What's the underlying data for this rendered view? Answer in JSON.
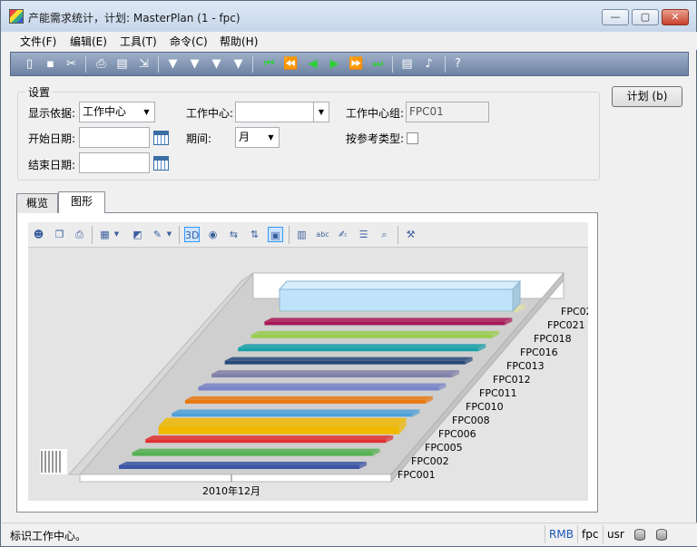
{
  "window": {
    "title": "产能需求统计，计划: MasterPlan (1 - fpc)",
    "controls": {
      "minimize": "—",
      "maximize": "▢",
      "close": "✕"
    }
  },
  "menu": {
    "items": [
      {
        "label": "文件(F)"
      },
      {
        "label": "编辑(E)"
      },
      {
        "label": "工具(T)"
      },
      {
        "label": "命令(C)"
      },
      {
        "label": "帮助(H)"
      }
    ]
  },
  "toolbar": {
    "icons": [
      "new-icon",
      "save-icon",
      "cut-icon",
      "print-icon",
      "print-preview-icon",
      "export-icon",
      "filter-icon",
      "filter-add-icon",
      "filter-edit-icon",
      "filter-clear-icon",
      "first-record-icon",
      "previous-page-icon",
      "previous-record-icon",
      "next-record-icon",
      "next-page-icon",
      "last-record-icon",
      "notes-icon",
      "alert-bell-icon",
      "help-icon"
    ]
  },
  "settings": {
    "group_label": "设置",
    "display_by_label": "显示依据:",
    "display_by_value": "工作中心",
    "work_center_label": "工作中心:",
    "work_center_value": "",
    "work_center_group_label": "工作中心组:",
    "work_center_group_value": "FPC01",
    "start_date_label": "开始日期:",
    "start_date_value": "",
    "period_label": "期间:",
    "period_value": "月",
    "by_ref_type_label": "按参考类型:",
    "by_ref_type_checked": false,
    "end_date_label": "结束日期:",
    "end_date_value": "",
    "plan_button": "计划 (b)"
  },
  "tabs": [
    {
      "label": "概览",
      "active": false
    },
    {
      "label": "图形",
      "active": true
    }
  ],
  "chart_toolbar": {
    "icons": [
      "chart-wizard-icon",
      "copy-icon",
      "print-icon",
      "gallery-icon",
      "color-icon",
      "palette-icon",
      "3d-icon",
      "rotate-icon",
      "axis-horizontal-icon",
      "axis-vertical-icon",
      "clustered-icon",
      "data-editor-icon",
      "abc-labels-icon",
      "properties-icon",
      "legend-icon",
      "zoom-icon",
      "tools-icon"
    ]
  },
  "chart_data": {
    "type": "bar",
    "category": "2010年12月",
    "series": [
      {
        "name": "FPC001",
        "color": "#3c55a5",
        "value": 100
      },
      {
        "name": "FPC002",
        "color": "#54b050",
        "value": 100
      },
      {
        "name": "FPC005",
        "color": "#e03030",
        "value": 100
      },
      {
        "name": "FPC006",
        "color": "#f0b800",
        "value": 100
      },
      {
        "name": "FPC008",
        "color": "#4ea0d8",
        "value": 100
      },
      {
        "name": "FPC010",
        "color": "#e87810",
        "value": 100
      },
      {
        "name": "FPC011",
        "color": "#7a84c8",
        "value": 100
      },
      {
        "name": "FPC012",
        "color": "#8080a8",
        "value": 100
      },
      {
        "name": "FPC013",
        "color": "#284a7a",
        "value": 100
      },
      {
        "name": "FPC016",
        "color": "#18a0a8",
        "value": 100
      },
      {
        "name": "FPC018",
        "color": "#9acd50",
        "value": 100
      },
      {
        "name": "FPC021",
        "color": "#a81858",
        "value": 100
      },
      {
        "name": "FPC02",
        "color": "#e0e0a8",
        "value": 100
      }
    ],
    "labels": [
      "FPC001",
      "FPC002",
      "FPC005",
      "FPC006",
      "FPC008",
      "FPC010",
      "FPC011",
      "FPC012",
      "FPC013",
      "FPC016",
      "FPC018",
      "FPC021",
      "FPC02"
    ],
    "top_bar_color": "#bfe3f8",
    "grid": false
  },
  "status": {
    "message": "标识工作中心。",
    "currency": "RMB",
    "company": "fpc",
    "user": "usr"
  }
}
